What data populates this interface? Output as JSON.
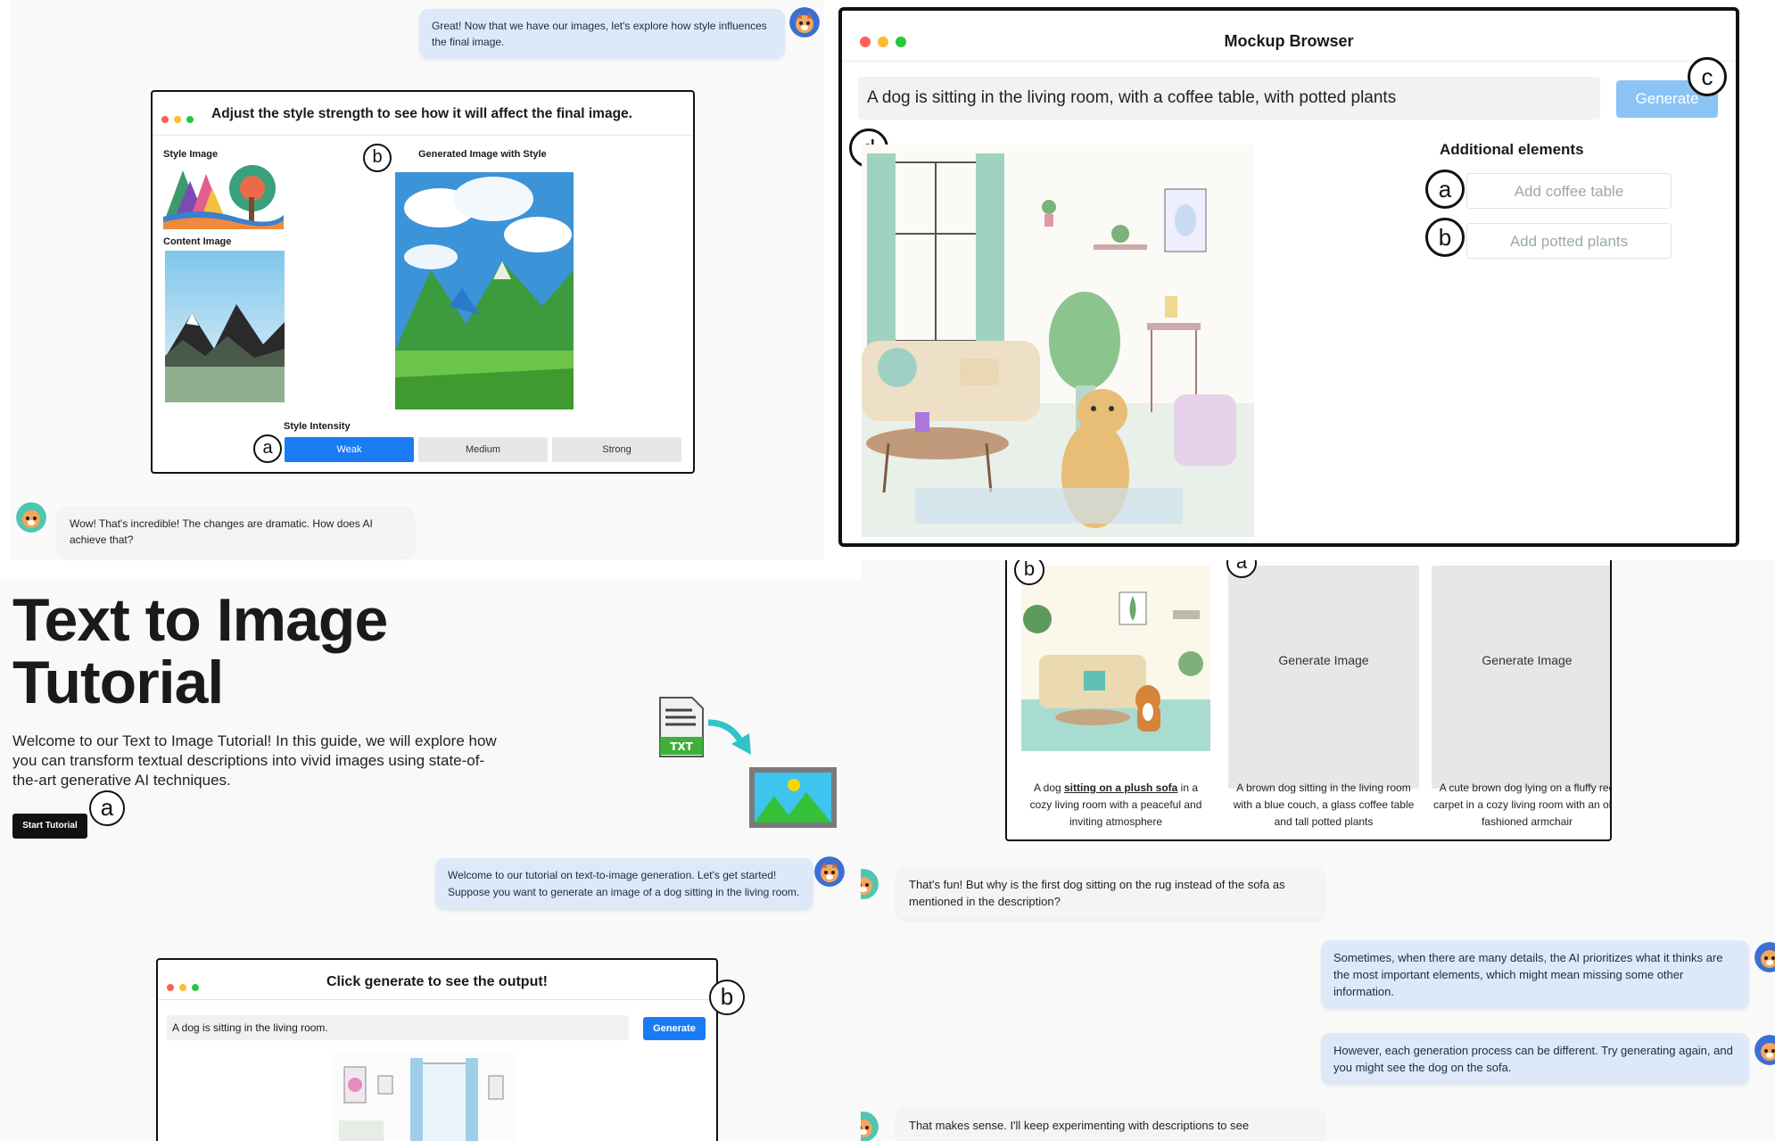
{
  "style_panel": {
    "assistant_msg": "Great! Now that we have our images, let's explore how style influences the final image.",
    "window_title": "Adjust the style strength to see how it will affect the final image.",
    "style_image_label": "Style Image",
    "content_image_label": "Content Image",
    "generated_label": "Generated Image with Style",
    "intensity_label": "Style Intensity",
    "intensity_options": [
      "Weak",
      "Medium",
      "Strong"
    ],
    "selected_intensity": "Weak",
    "marker_a": "a",
    "marker_b": "b",
    "user_msg": "Wow! That's incredible! The changes are dramatic. How does AI achieve that?"
  },
  "mockup_panel": {
    "window_title": "Mockup Browser",
    "prompt_value": "A dog is sitting in the living room, with a coffee table, with potted plants",
    "generate_label": "Generate",
    "additional_title": "Additional elements",
    "elements": [
      "Add coffee table",
      "Add potted plants"
    ],
    "marker_a": "a",
    "marker_b": "b",
    "marker_c": "c",
    "marker_d": "d"
  },
  "tutorial_panel": {
    "title_line1": "Text to Image",
    "title_line2": "Tutorial",
    "intro": "Welcome to our Text to Image Tutorial! In this guide, we will explore how you can transform textual descriptions into vivid images using state-of-the-art generative AI techniques.",
    "start_button": "Start Tutorial",
    "txt_label": "TXT",
    "marker_a": "a",
    "assistant_msg": "Welcome to our tutorial on text-to-image generation. Let's get started! Suppose you want to generate an image of a dog sitting in the living room.",
    "window_title": "Click generate to see the output!",
    "prompt_value": "A dog is sitting in the living room.",
    "generate_label": "Generate",
    "marker_b": "b"
  },
  "gallery_panel": {
    "marker_b": "b",
    "marker_a": "a",
    "placeholder_label": "Generate Image",
    "caption1_pre": "A dog ",
    "caption1_em": "sitting on a plush sofa",
    "caption1_post": " in a cozy living room with a peaceful and inviting atmosphere",
    "caption2": "A brown dog sitting in the living room with a blue couch, a glass coffee table and tall potted plants",
    "caption3": "A cute brown dog lying on a fluffy red carpet in a cozy living room with an old-fashioned armchair",
    "user_msg1": "That's fun! But why is the first dog sitting on the rug instead of the sofa as mentioned in the description?",
    "assistant_msg1": "Sometimes, when there are many details, the AI prioritizes what it thinks are the most important elements, which might mean missing some other information.",
    "assistant_msg2": "However, each generation process can be different. Try generating again, and you might see the dog on the sofa.",
    "user_msg2": "That makes sense. I'll keep experimenting with descriptions to see"
  },
  "colors": {
    "accent": "#1a7cf5",
    "bubble_assistant": "#dde9f9",
    "bubble_user": "#f3f4f6",
    "dot_red": "#ff5f57",
    "dot_yellow": "#febc2e",
    "dot_green": "#28c840"
  }
}
